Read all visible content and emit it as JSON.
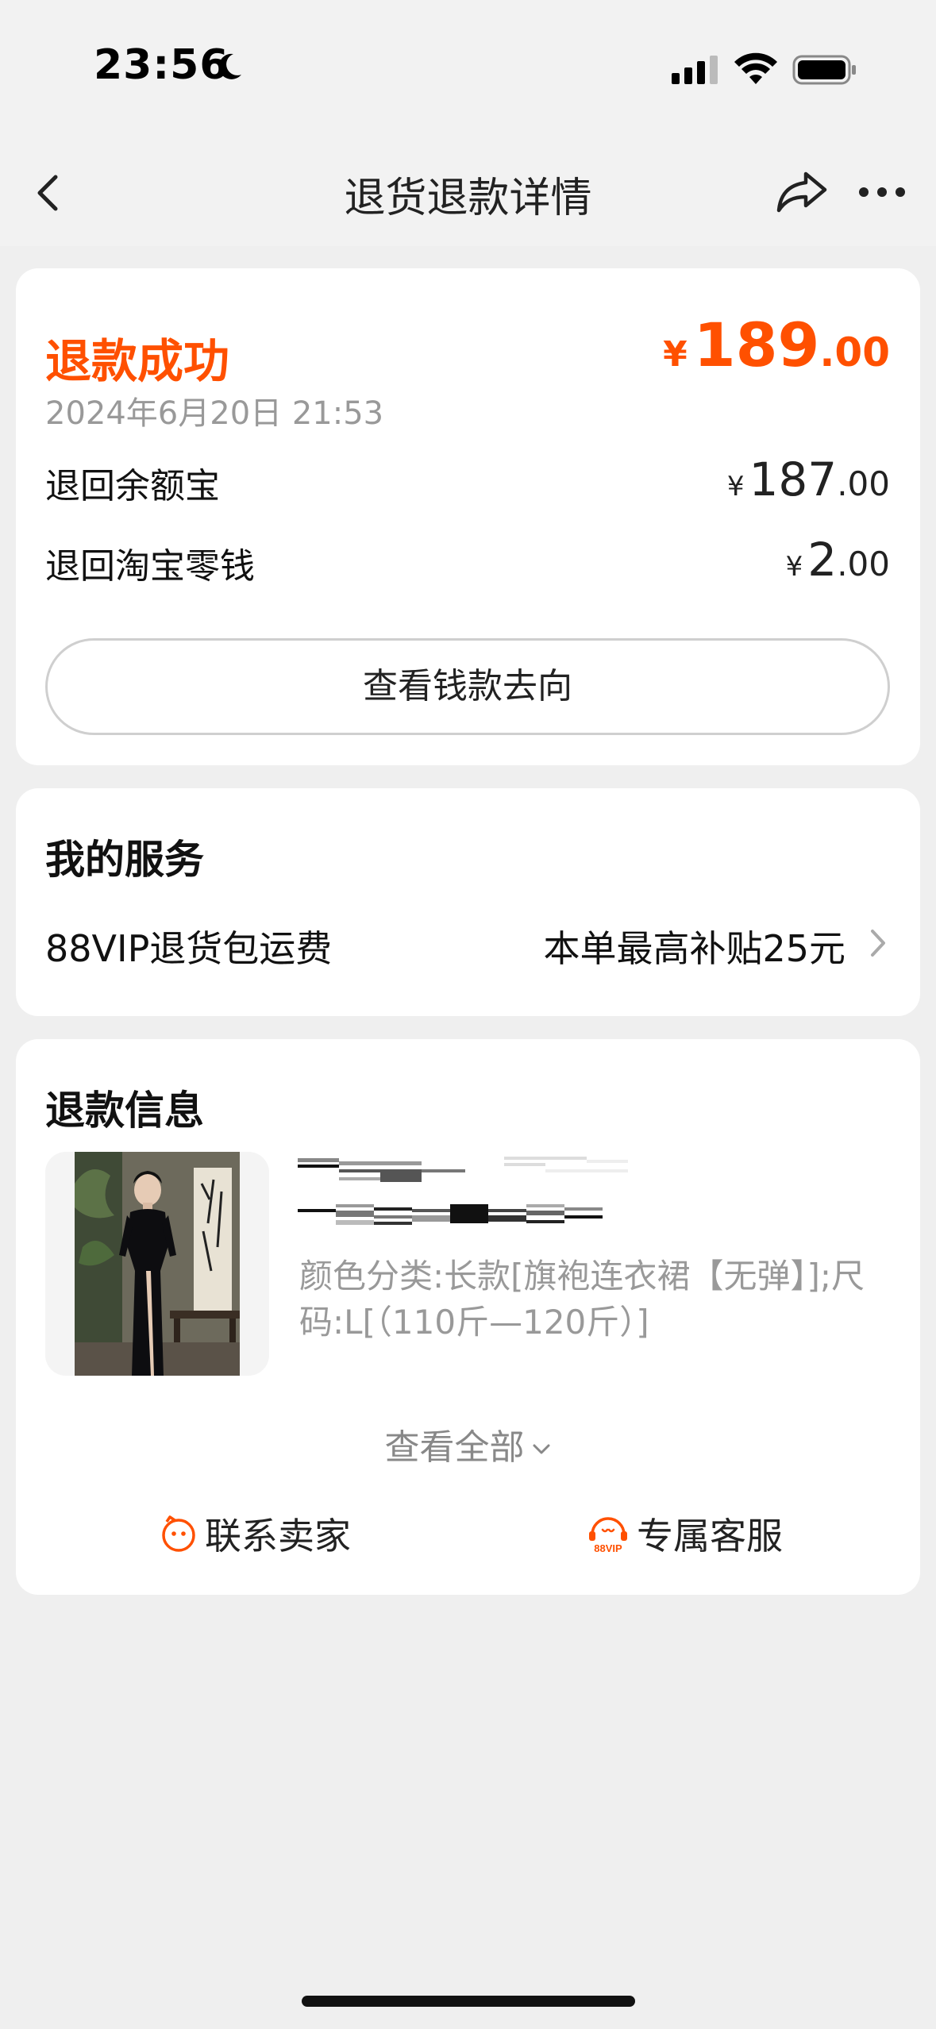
{
  "status_bar": {
    "time": "23:56"
  },
  "nav": {
    "title": "退货退款详情"
  },
  "refund": {
    "status": "退款成功",
    "total": {
      "currency": "¥",
      "integer": "189",
      "decimal": ".00"
    },
    "date": "2024年6月20日 21:53",
    "rows": [
      {
        "label": "退回余额宝",
        "currency": "¥",
        "integer": "187",
        "decimal": ".00"
      },
      {
        "label": "退回淘宝零钱",
        "currency": "¥",
        "integer": "2",
        "decimal": ".00"
      }
    ],
    "button_label": "查看钱款去向"
  },
  "services": {
    "title": "我的服务",
    "item": {
      "label": "88VIP退货包运费",
      "value": "本单最高补贴25元"
    }
  },
  "info": {
    "title": "退款信息",
    "product_spec": "颜色分类:长款[旗袍连衣裙【无弹】];尺码:L[（110斤—120斤）]",
    "view_all": "查看全部",
    "actions": {
      "contact_seller": "联系卖家",
      "exclusive_service": "专属客服"
    }
  },
  "icons": {
    "back": "chevron-left-icon",
    "share": "share-icon",
    "more": "more-icon",
    "moon": "moon-icon",
    "seller": "seller-face-icon",
    "service": "88vip-headset-icon"
  },
  "colors": {
    "accent": "#ff5000",
    "page_bg": "#efefef",
    "card_bg": "#ffffff",
    "muted": "#999999"
  }
}
